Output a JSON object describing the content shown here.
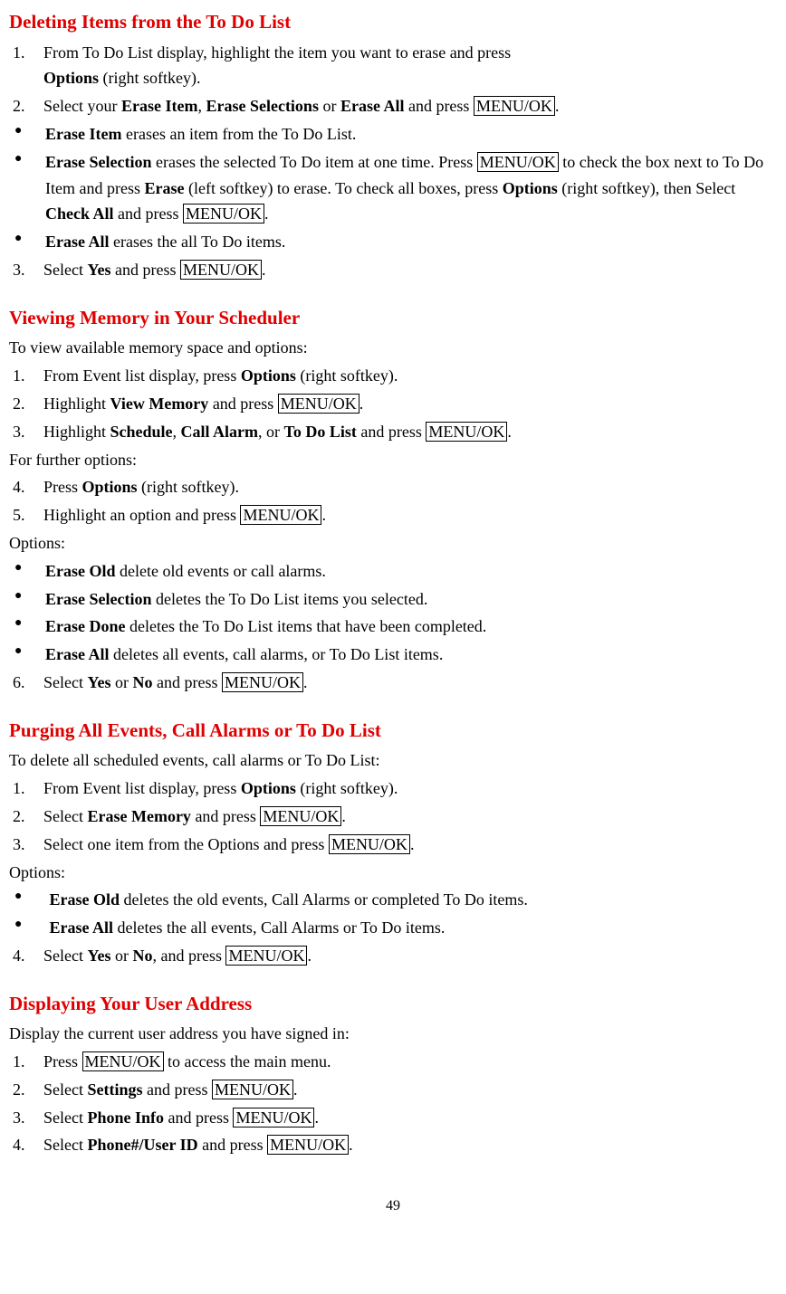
{
  "s1": {
    "heading": "Deleting Items from the To Do List",
    "i1_n": "1.",
    "i1_a": "From To Do List display, highlight the item you want to erase and press",
    "i1_b1": "Options",
    "i1_b2": " (right softkey).",
    "i2_n": "2.",
    "i2_a": "Select your ",
    "i2_b1": "Erase Item",
    "i2_c1": ", ",
    "i2_b2": "Erase Selections",
    "i2_c2": " or ",
    "i2_b3": "Erase All",
    "i2_c3": " and press ",
    "i2_k": "MENU/OK",
    "i2_c4": ".",
    "b1_b": "Erase Item",
    "b1_t": " erases an item from the To Do List.",
    "b2_b": "Erase Selection",
    "b2_t1": " erases the selected To Do item at one time. Press ",
    "b2_k1": "MENU/OK",
    "b2_t2": " to check the box next to To Do Item and press ",
    "b2_b2": "Erase",
    "b2_t3": " (left softkey) to erase. To check all boxes, press ",
    "b2_b3": "Options",
    "b2_t4": " (right softkey), then Select ",
    "b2_b4": "Check All",
    "b2_t5": " and press ",
    "b2_k2": "MENU/OK",
    "b2_t6": ".",
    "b3_b": "Erase All",
    "b3_t": " erases the all To Do items.",
    "i3_n": "3.",
    "i3_a": "Select ",
    "i3_b": "Yes",
    "i3_c": " and press ",
    "i3_k": "MENU/OK",
    "i3_d": "."
  },
  "s2": {
    "heading": "Viewing Memory in Your Scheduler",
    "intro": "To view available memory space and options:",
    "i1_n": "1.",
    "i1_a": "From Event list display, press ",
    "i1_b": "Options",
    "i1_c": " (right softkey).",
    "i2_n": "2.",
    "i2_a": "Highlight ",
    "i2_b": "View Memory",
    "i2_c": " and press ",
    "i2_k": "MENU/OK",
    "i2_d": ".",
    "i3_n": "3.",
    "i3_a": "Highlight ",
    "i3_b1": "Schedule",
    "i3_c1": ", ",
    "i3_b2": "Call Alarm",
    "i3_c2": ", or ",
    "i3_b3": "To Do List",
    "i3_c3": " and press ",
    "i3_k": "MENU/OK",
    "i3_d": ".",
    "further": "For further options:",
    "i4_n": "4.",
    "i4_a": "Press ",
    "i4_b": "Options",
    "i4_c": " (right softkey).",
    "i5_n": "5.",
    "i5_a": "Highlight an option and press ",
    "i5_k": "MENU/OK",
    "i5_b": ".",
    "options": "Options:",
    "b1_b": "Erase Old",
    "b1_t": " delete old events or call alarms.",
    "b2_b": "Erase Selection",
    "b2_t": " deletes the To Do List items you selected.",
    "b3_b": "Erase Done",
    "b3_t": " deletes the To Do List items that have been completed.",
    "b4_b": "Erase All",
    "b4_t": " deletes all events, call alarms, or To Do List items.",
    "i6_n": "6.",
    "i6_a": "Select ",
    "i6_b1": "Yes",
    "i6_c1": " or ",
    "i6_b2": "No",
    "i6_c2": " and press ",
    "i6_k": "MENU/OK",
    "i6_d": "."
  },
  "s3": {
    "heading": "Purging All Events, Call Alarms or To Do List",
    "intro": "To delete all scheduled events, call alarms or To Do List:",
    "i1_n": "1.",
    "i1_a": "From Event list display, press ",
    "i1_b": "Options",
    "i1_c": " (right softkey).",
    "i2_n": "2.",
    "i2_a": "Select ",
    "i2_b": "Erase Memory",
    "i2_c": " and press ",
    "i2_k": "MENU/OK",
    "i2_d": ".",
    "i3_n": "3.",
    "i3_a": "Select one item from the Options and press ",
    "i3_k": "MENU/OK",
    "i3_b": ".",
    "options": "Options:",
    "b1_b": "Erase Old",
    "b1_t": " deletes the old events, Call Alarms or completed To Do items.",
    "b2_b": "Erase All",
    "b2_t": " deletes the all events, Call Alarms or To Do items.",
    "i4_n": "4.",
    "i4_a": "Select ",
    "i4_b1": "Yes",
    "i4_c1": " or ",
    "i4_b2": "No",
    "i4_c2": ", and press ",
    "i4_k": "MENU/OK",
    "i4_d": "."
  },
  "s4": {
    "heading": "Displaying Your User Address",
    "intro": "Display the current user address you have signed in:",
    "i1_n": "1.",
    "i1_a": "Press ",
    "i1_k": "MENU/OK",
    "i1_b": " to access the main menu.",
    "i2_n": "2.",
    "i2_a": "Select ",
    "i2_b": "Settings",
    "i2_c": " and press ",
    "i2_k": "MENU/OK",
    "i2_d": ".",
    "i3_n": "3.",
    "i3_a": "Select ",
    "i3_b": "Phone Info",
    "i3_c": " and press ",
    "i3_k": "MENU/OK",
    "i3_d": ".",
    "i4_n": "4.",
    "i4_a": "Select ",
    "i4_b": "Phone#/User ID",
    "i4_c": " and press ",
    "i4_k": "MENU/OK",
    "i4_d": "."
  },
  "page": "49"
}
